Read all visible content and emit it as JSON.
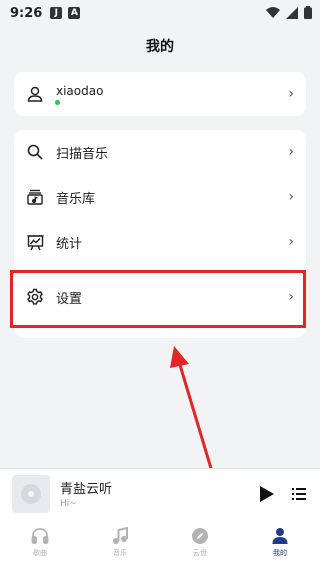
{
  "status_bar": {
    "time": "9:26",
    "app_badge_1": "J",
    "app_badge_2": "A"
  },
  "page": {
    "title": "我的"
  },
  "user": {
    "name": "xiaodao",
    "online_color": "#2bc84b"
  },
  "menu": {
    "items": [
      {
        "label": "扫描音乐",
        "icon": "search-icon"
      },
      {
        "label": "音乐库",
        "icon": "music-library-icon"
      },
      {
        "label": "统计",
        "icon": "chart-icon"
      }
    ],
    "settings": {
      "label": "设置",
      "icon": "gear-icon"
    }
  },
  "annotation": {
    "highlight_color": "#e42525"
  },
  "player": {
    "title": "青盐云听",
    "subtitle": "Hi~"
  },
  "tabs": [
    {
      "label": "歌曲",
      "icon": "headphones-icon",
      "active": false
    },
    {
      "label": "音乐",
      "icon": "music-note-icon",
      "active": false
    },
    {
      "label": "云盘",
      "icon": "compass-icon",
      "active": false
    },
    {
      "label": "我的",
      "icon": "person-icon",
      "active": true
    }
  ],
  "colors": {
    "accent": "#1f3c8c",
    "inactive": "#b3b3b3"
  }
}
